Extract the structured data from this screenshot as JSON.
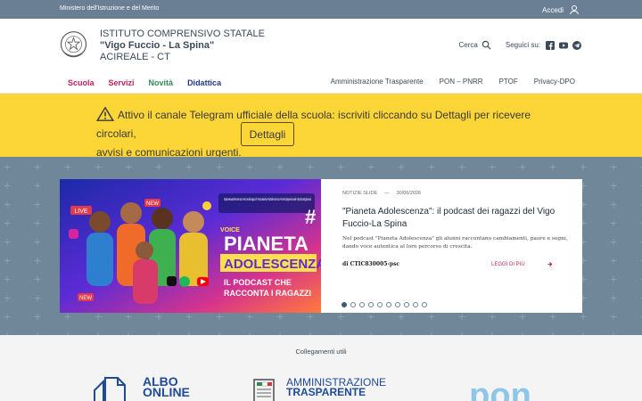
{
  "topbar": {
    "ministry": "Ministero dell'Istruzione e del Merito",
    "login_label": "Accedi"
  },
  "header": {
    "school_line1": "ISTITUTO COMPRENSIVO STATALE",
    "school_line2": "\"Vigo Fuccio - La Spina\"",
    "school_line3": "ACIREALE - CT",
    "search_label": "Cerca",
    "follow_label": "Seguici su:",
    "social_icons": [
      "facebook-icon",
      "youtube-icon",
      "telegram-icon"
    ]
  },
  "nav": {
    "left": [
      "Scuola",
      "Servizi",
      "Novità",
      "Didattica"
    ],
    "right": [
      "Amministrazione Trasparente",
      "PON – PNRR",
      "PTOF",
      "Privacy-DPO"
    ]
  },
  "alert": {
    "line1": "Attivo il canale Telegram ufficiale della scuola: iscriviti cliccando su Dettagli per ricevere circolari,",
    "line2": "avvisi e comunicazioni urgenti.",
    "button_label": "Dettagli"
  },
  "slide": {
    "image_text": {
      "hashtags": "#pianetaadolescenza #vocedeiragazzi #scuolavita #adolescenza #crescitapersonale #podcastgiovani",
      "title1": "PIANETA",
      "title2": "ADOLESCENZA",
      "subtitle1": "IL PODCAST CHE",
      "subtitle2": "RACCONTA I RAGAZZI",
      "live": "LIVE",
      "new1": "NEW",
      "new2": "NEW",
      "voice": "VOICE"
    },
    "category": "NOTIZIE SLIDE",
    "separator": "—",
    "date": "30/06/2026",
    "title": "\"Pianeta Adolescenza\": il podcast dei ragazzi del Vigo Fuccio-La Spina",
    "text": "Nel podcast \"Pianeta Adolescenza\" gli alunni raccontano cambiamenti, paure e sogni, dando voce autentica al loro percorso di crescita.",
    "author": "di CTIC830005-psc",
    "more_label": "LEGGI DI PIÙ",
    "dots_total": 10,
    "dots_active_index": 0
  },
  "links": {
    "title": "Collegamenti utili",
    "albo_line1": "ALBO",
    "albo_line2": "ONLINE",
    "amm_line1": "AMMINISTRAZIONE",
    "amm_line2": "TRASPARENTE",
    "pon_label": "pon"
  },
  "colors": {
    "topbar": "#6a7f93",
    "alert": "#fcd536",
    "hero": "#6f8799",
    "accent": "#c0225f",
    "link_blue": "#1f4a9a"
  }
}
